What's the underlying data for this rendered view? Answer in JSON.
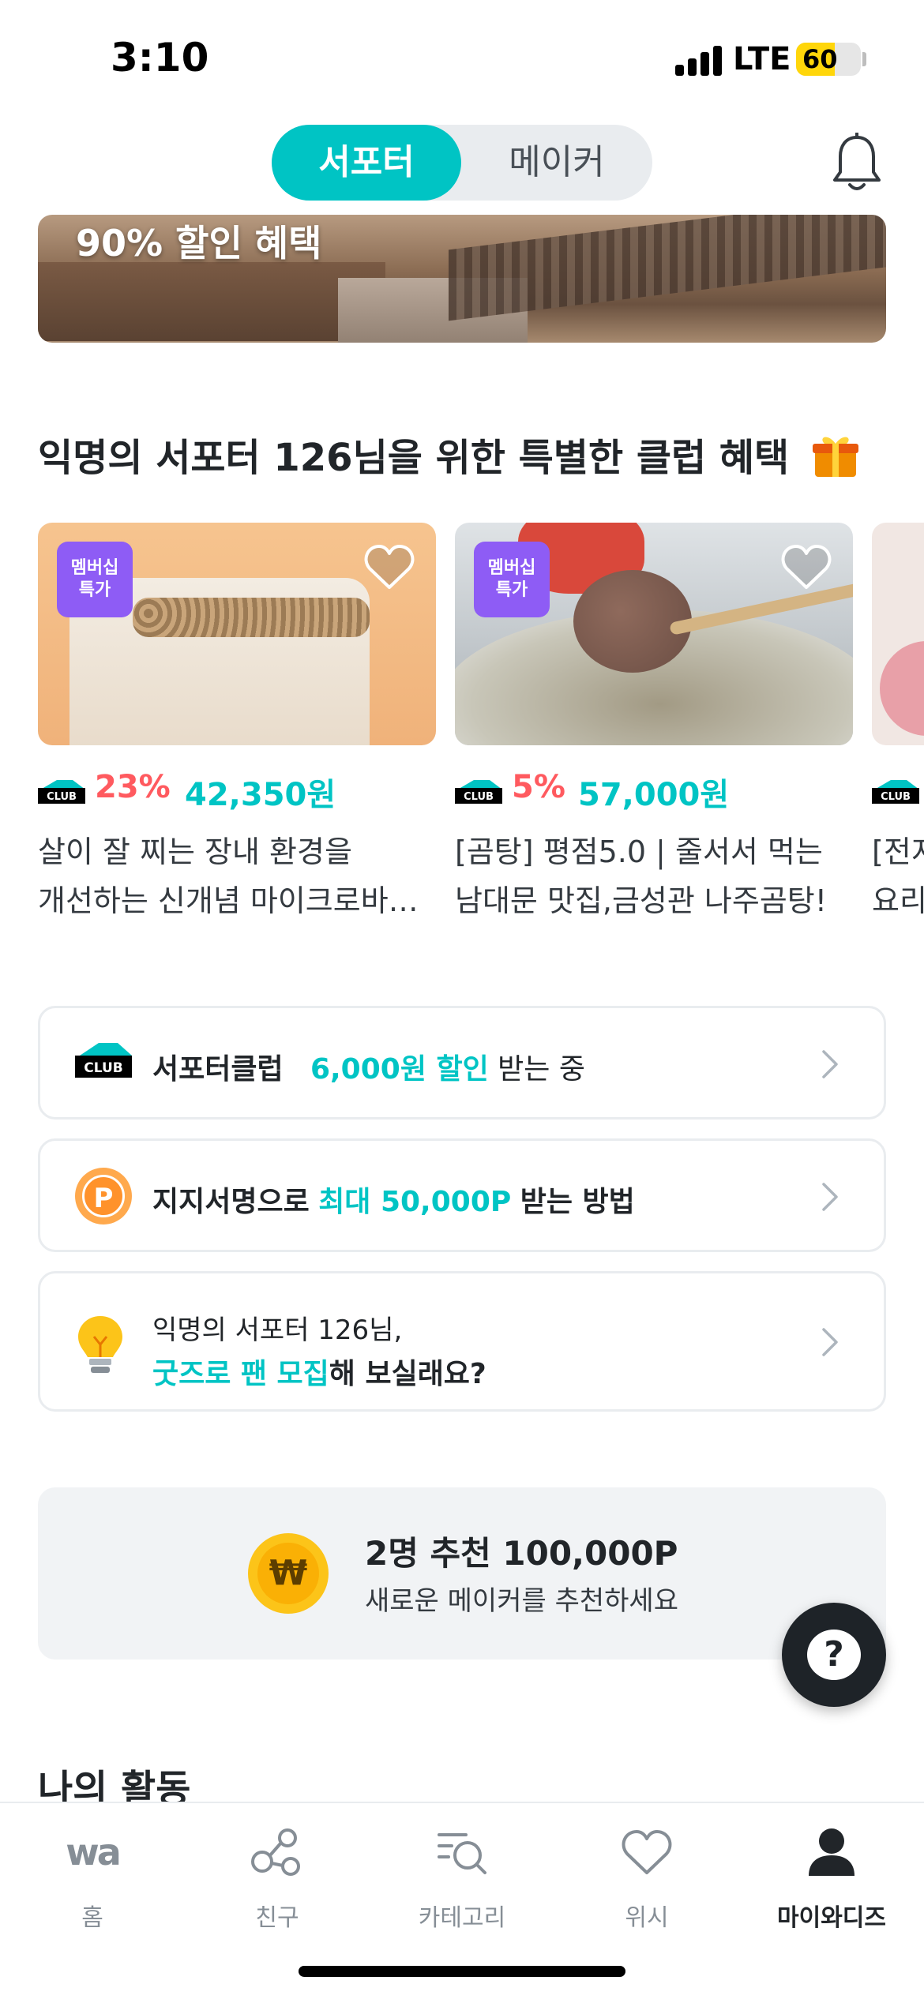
{
  "status": {
    "time": "3:10",
    "network": "LTE",
    "battery": "60",
    "battery_level": 0.6
  },
  "header": {
    "toggle": {
      "active": "서포터",
      "inactive": "메이커"
    }
  },
  "banner": {
    "text": "90% 할인 혜택"
  },
  "club_section": {
    "title": "익명의 서포터 126님을 위한 특별한 클럽 혜택",
    "products": [
      {
        "badge_line1": "멤버십",
        "badge_line2": "특가",
        "discount": "23%",
        "price": "42,350원",
        "desc_line1": "살이 잘 찌는 장내 환경을",
        "desc_line2": "개선하는 신개념 마이크로바…"
      },
      {
        "badge_line1": "멤버십",
        "badge_line2": "특가",
        "discount": "5%",
        "price": "57,000원",
        "desc_line1": "[곰탕] 평점5.0 | 줄서서 먹는",
        "desc_line2": "남대문 맛집,금성관 나주곰탕!"
      },
      {
        "desc_line1": "[전지",
        "desc_line2": "요리"
      }
    ]
  },
  "info_rows": {
    "club": {
      "prefix": "서포터클럽",
      "highlight": "6,000원 할인",
      "suffix": "받는 중"
    },
    "points": {
      "prefix": "지지서명으로",
      "highlight": "최대 50,000P",
      "suffix": "받는 방법"
    },
    "goods": {
      "line1": "익명의 서포터 126님,",
      "highlight": "굿즈로 팬 모집",
      "suffix": "해 보실래요?"
    }
  },
  "referral": {
    "coin": "₩",
    "title": "2명 추천  100,000P",
    "subtitle": "새로운 메이커를 추천하세요"
  },
  "help": {
    "label": "?"
  },
  "activity": {
    "title": "나의 활동"
  },
  "tab_bar": {
    "items": [
      {
        "label": "홈",
        "icon": "wa-logo-icon"
      },
      {
        "label": "친구",
        "icon": "share-network-icon"
      },
      {
        "label": "카테고리",
        "icon": "category-search-icon"
      },
      {
        "label": "위시",
        "icon": "heart-icon"
      },
      {
        "label": "마이와디즈",
        "icon": "person-icon"
      }
    ],
    "active_index": 4
  },
  "colors": {
    "accent": "#00c4c4",
    "discount": "#ff5a5f",
    "badge": "#8e5cf5",
    "coin": "#fcc419"
  }
}
